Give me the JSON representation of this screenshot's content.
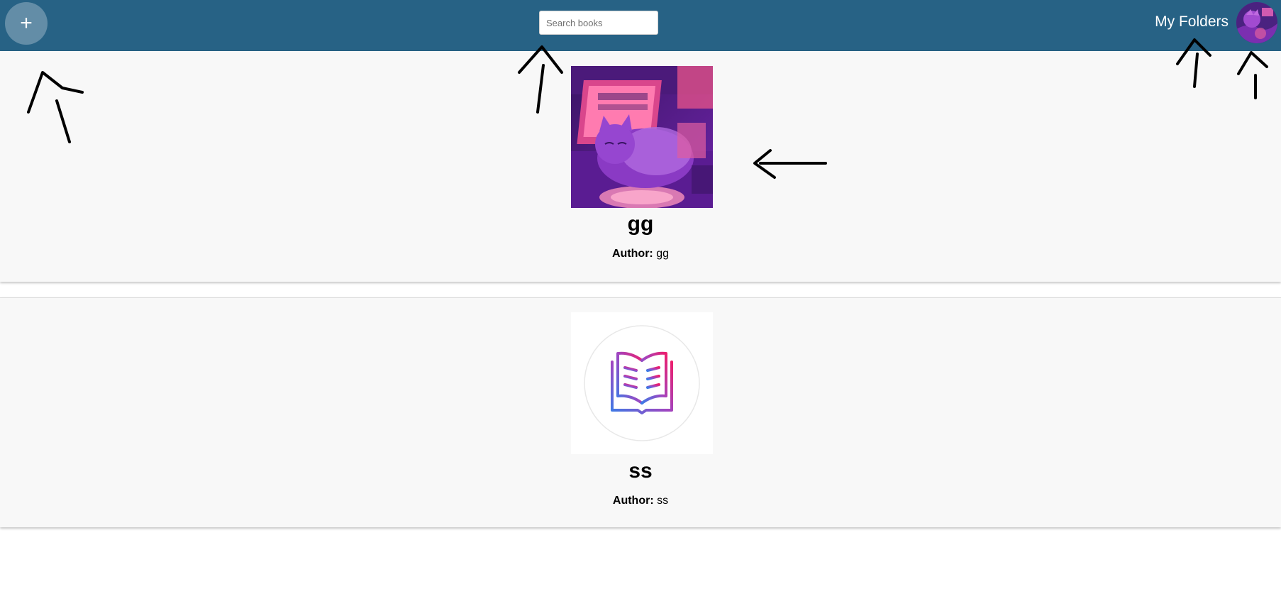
{
  "header": {
    "add_label": "+",
    "search_placeholder": "Search books",
    "my_folders_label": "My Folders",
    "bar_color": "#276285"
  },
  "books": [
    {
      "title": "gg",
      "author_label": "Author:",
      "author": "gg",
      "cover_icon": "cat-illustration-cover"
    },
    {
      "title": "ss",
      "author_label": "Author:",
      "author": "ss",
      "cover_icon": "open-book-icon"
    }
  ]
}
